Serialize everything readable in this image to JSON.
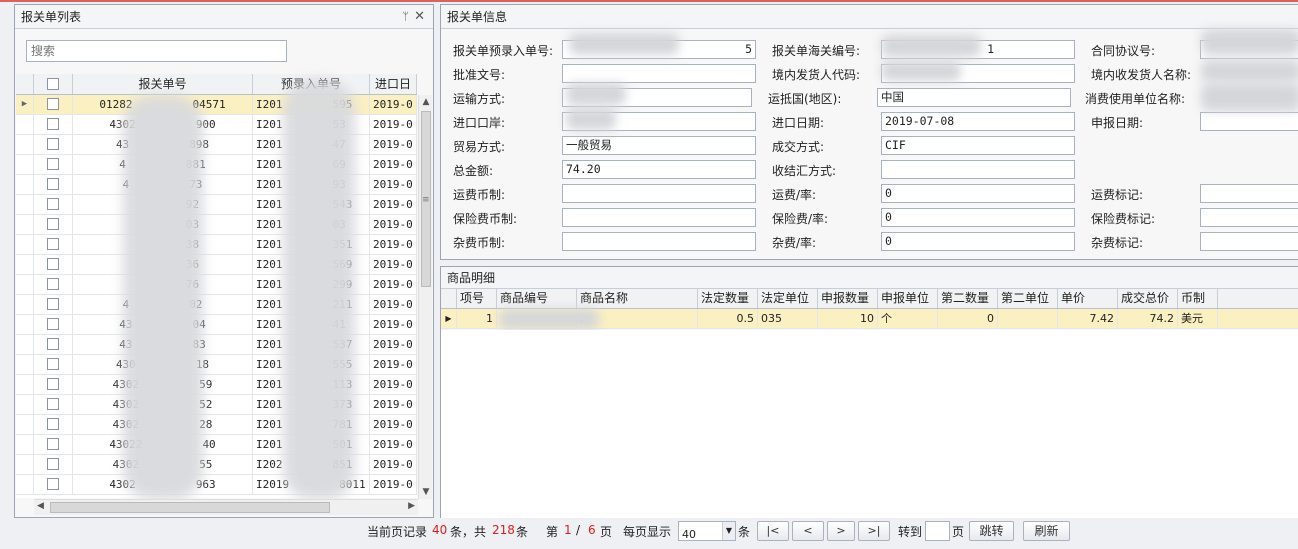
{
  "left_panel": {
    "title": "报关单列表",
    "pin_glyph": "ᛘ",
    "close_glyph": "✕",
    "search_placeholder": "搜索",
    "columns": [
      "",
      "报关单号",
      "预录入单号",
      "进口日"
    ],
    "rows": [
      {
        "no": "01282",
        "no2": "04571",
        "pre": "I201",
        "pre2": "595",
        "date": "2019-0"
      },
      {
        "no": "4302",
        "no2": "900",
        "pre": "I201",
        "pre2": "53",
        "date": "2019-0"
      },
      {
        "no": "43",
        "no2": "898",
        "pre": "I201",
        "pre2": "47",
        "date": "2019-0"
      },
      {
        "no": "4",
        "no2": "881",
        "pre": "I201",
        "pre2": "69",
        "date": "2019-0"
      },
      {
        "no": "4",
        "no2": "73",
        "pre": "I201",
        "pre2": "93",
        "date": "2019-0"
      },
      {
        "no": "",
        "no2": "92",
        "pre": "I201",
        "pre2": "543",
        "date": "2019-0"
      },
      {
        "no": "",
        "no2": "03",
        "pre": "I201",
        "pre2": "03",
        "date": "2019-0"
      },
      {
        "no": "",
        "no2": "38",
        "pre": "I201",
        "pre2": "351",
        "date": "2019-0"
      },
      {
        "no": "",
        "no2": "36",
        "pre": "I201",
        "pre2": "569",
        "date": "2019-0"
      },
      {
        "no": "",
        "no2": "76",
        "pre": "I201",
        "pre2": "299",
        "date": "2019-0"
      },
      {
        "no": "4",
        "no2": "02",
        "pre": "I201",
        "pre2": "211",
        "date": "2019-0"
      },
      {
        "no": "43",
        "no2": "04",
        "pre": "I201",
        "pre2": "41",
        "date": "2019-0"
      },
      {
        "no": "43",
        "no2": "83",
        "pre": "I201",
        "pre2": "537",
        "date": "2019-0"
      },
      {
        "no": "430",
        "no2": "18",
        "pre": "I201",
        "pre2": "555",
        "date": "2019-0"
      },
      {
        "no": "4302",
        "no2": "59",
        "pre": "I201",
        "pre2": "113",
        "date": "2019-0"
      },
      {
        "no": "4302",
        "no2": "52",
        "pre": "I201",
        "pre2": "373",
        "date": "2019-0"
      },
      {
        "no": "4302",
        "no2": "28",
        "pre": "I201",
        "pre2": "781",
        "date": "2019-0"
      },
      {
        "no": "43022",
        "no2": "40",
        "pre": "I201",
        "pre2": "501",
        "date": "2019-0"
      },
      {
        "no": "4302",
        "no2": "55",
        "pre": "I202",
        "pre2": "851",
        "date": "2019-0"
      },
      {
        "no": "4302",
        "no2": "963",
        "pre": "I2019",
        "pre2": "8011",
        "date": "2019-0"
      }
    ]
  },
  "info_panel": {
    "title": "报关单信息",
    "fields": {
      "pre_entry_no": {
        "label": "报关单预录入单号:",
        "value": "5"
      },
      "customs_no": {
        "label": "报关单海关编号:",
        "value": "1"
      },
      "contract_no": {
        "label": "合同协议号:",
        "value": ""
      },
      "approval_no": {
        "label": "批准文号:",
        "value": ""
      },
      "consignor_code": {
        "label": "境内发货人代码:",
        "value": ""
      },
      "consignee_name": {
        "label": "境内收发货人名称:",
        "value": ""
      },
      "transport_mode": {
        "label": "运输方式:",
        "value": ""
      },
      "arrival_country": {
        "label": "运抵国(地区):",
        "value": "中国"
      },
      "consumer_unit": {
        "label": "消费使用单位名称:",
        "value": ""
      },
      "entry_port": {
        "label": "进口口岸:",
        "value": ""
      },
      "import_date": {
        "label": "进口日期:",
        "value": "2019-07-08"
      },
      "declare_date": {
        "label": "申报日期:",
        "value": ""
      },
      "trade_mode": {
        "label": "贸易方式:",
        "value": "一般贸易"
      },
      "deal_mode": {
        "label": "成交方式:",
        "value": "CIF"
      },
      "total_amount": {
        "label": "总金额:",
        "value": "74.20"
      },
      "settlement": {
        "label": "收结汇方式:",
        "value": ""
      },
      "freight_currency": {
        "label": "运费币制:",
        "value": ""
      },
      "freight_rate": {
        "label": "运费/率:",
        "value": "0"
      },
      "freight_mark": {
        "label": "运费标记:",
        "value": ""
      },
      "insurance_currency": {
        "label": "保险费币制:",
        "value": ""
      },
      "insurance_rate": {
        "label": "保险费/率:",
        "value": "0"
      },
      "insurance_mark": {
        "label": "保险费标记:",
        "value": ""
      },
      "misc_currency": {
        "label": "杂费币制:",
        "value": ""
      },
      "misc_rate": {
        "label": "杂费/率:",
        "value": "0"
      },
      "misc_mark": {
        "label": "杂费标记:",
        "value": ""
      }
    }
  },
  "goods_panel": {
    "title": "商品明细",
    "columns": [
      "项号",
      "商品编号",
      "商品名称",
      "法定数量",
      "法定单位",
      "申报数量",
      "申报单位",
      "第二数量",
      "第二单位",
      "单价",
      "成交总价",
      "币制"
    ],
    "row": {
      "item": "1",
      "code": "",
      "name": ".",
      "legal_qty": "0.5",
      "legal_unit": "035",
      "decl_qty": "10",
      "decl_unit": "个",
      "second_qty": "0",
      "second_unit": "",
      "price": "7.42",
      "total": "74.2",
      "currency": "美元"
    }
  },
  "pager": {
    "prefix": "当前页记录",
    "page_count": "40",
    "mid": "条，共",
    "total": "218",
    "suffix": "条",
    "page_word_pre": "第",
    "current_page": "1",
    "slash": "/",
    "total_pages": "6",
    "page_word": "页",
    "per_page_label": "每页显示",
    "per_page_value": "40",
    "per_page_unit": "条",
    "first_glyph": "|<",
    "prev_glyph": "<",
    "next_glyph": ">",
    "last_glyph": ">|",
    "goto_label": "转到",
    "goto_unit": "页",
    "jump_label": "跳转",
    "refresh_label": "刷新"
  }
}
